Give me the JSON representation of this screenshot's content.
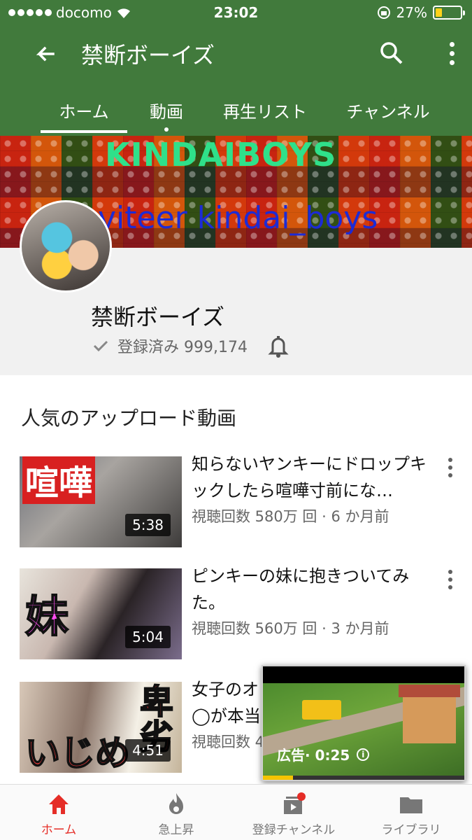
{
  "status_bar": {
    "carrier": "docomo",
    "time": "23:02",
    "battery": "27%",
    "battery_level": 0.27
  },
  "app_bar": {
    "title": "禁断ボーイズ",
    "tabs": [
      {
        "label": "ホーム",
        "active": true
      },
      {
        "label": "動画",
        "active": false
      },
      {
        "label": "再生リスト",
        "active": false
      },
      {
        "label": "チャンネル",
        "active": false
      }
    ]
  },
  "banner": {
    "title": "KINDAIBOYS",
    "subtitle": "viteer kindai_boys"
  },
  "channel": {
    "name": "禁断ボーイズ",
    "subscribed_label": "登録済み 999,174"
  },
  "section": {
    "title": "人気のアップロード動画"
  },
  "videos": [
    {
      "title": "知らないヤンキーにドロップキックしたら喧嘩寸前にな…",
      "meta": "視聴回数 580万 回 · 6 か月前",
      "duration": "5:38",
      "thumb_text": "喧嘩"
    },
    {
      "title": "ピンキーの妹に抱きついてみた。",
      "meta": "視聴回数 560万 回 · 3 か月前",
      "duration": "5:04",
      "thumb_text": "妹"
    },
    {
      "title": "女子のオ",
      "title_line2": "◯が本当",
      "meta": "視聴回数 4",
      "duration": "4:51",
      "thumb_text": "いじめ",
      "thumb_text2": "卑劣"
    }
  ],
  "mini_player": {
    "ad_label": "広告· 0:25",
    "progress": 0.15
  },
  "bottom_nav": [
    {
      "label": "ホーム",
      "icon": "home-icon",
      "active": true
    },
    {
      "label": "急上昇",
      "icon": "flame-icon",
      "active": false
    },
    {
      "label": "登録チャンネル",
      "icon": "subscriptions-icon",
      "active": false
    },
    {
      "label": "ライブラリ",
      "icon": "folder-icon",
      "active": false
    }
  ],
  "colors": {
    "app_bar": "#417a3c",
    "accent_red": "#e52d27",
    "battery_fill": "#ffd21a"
  }
}
